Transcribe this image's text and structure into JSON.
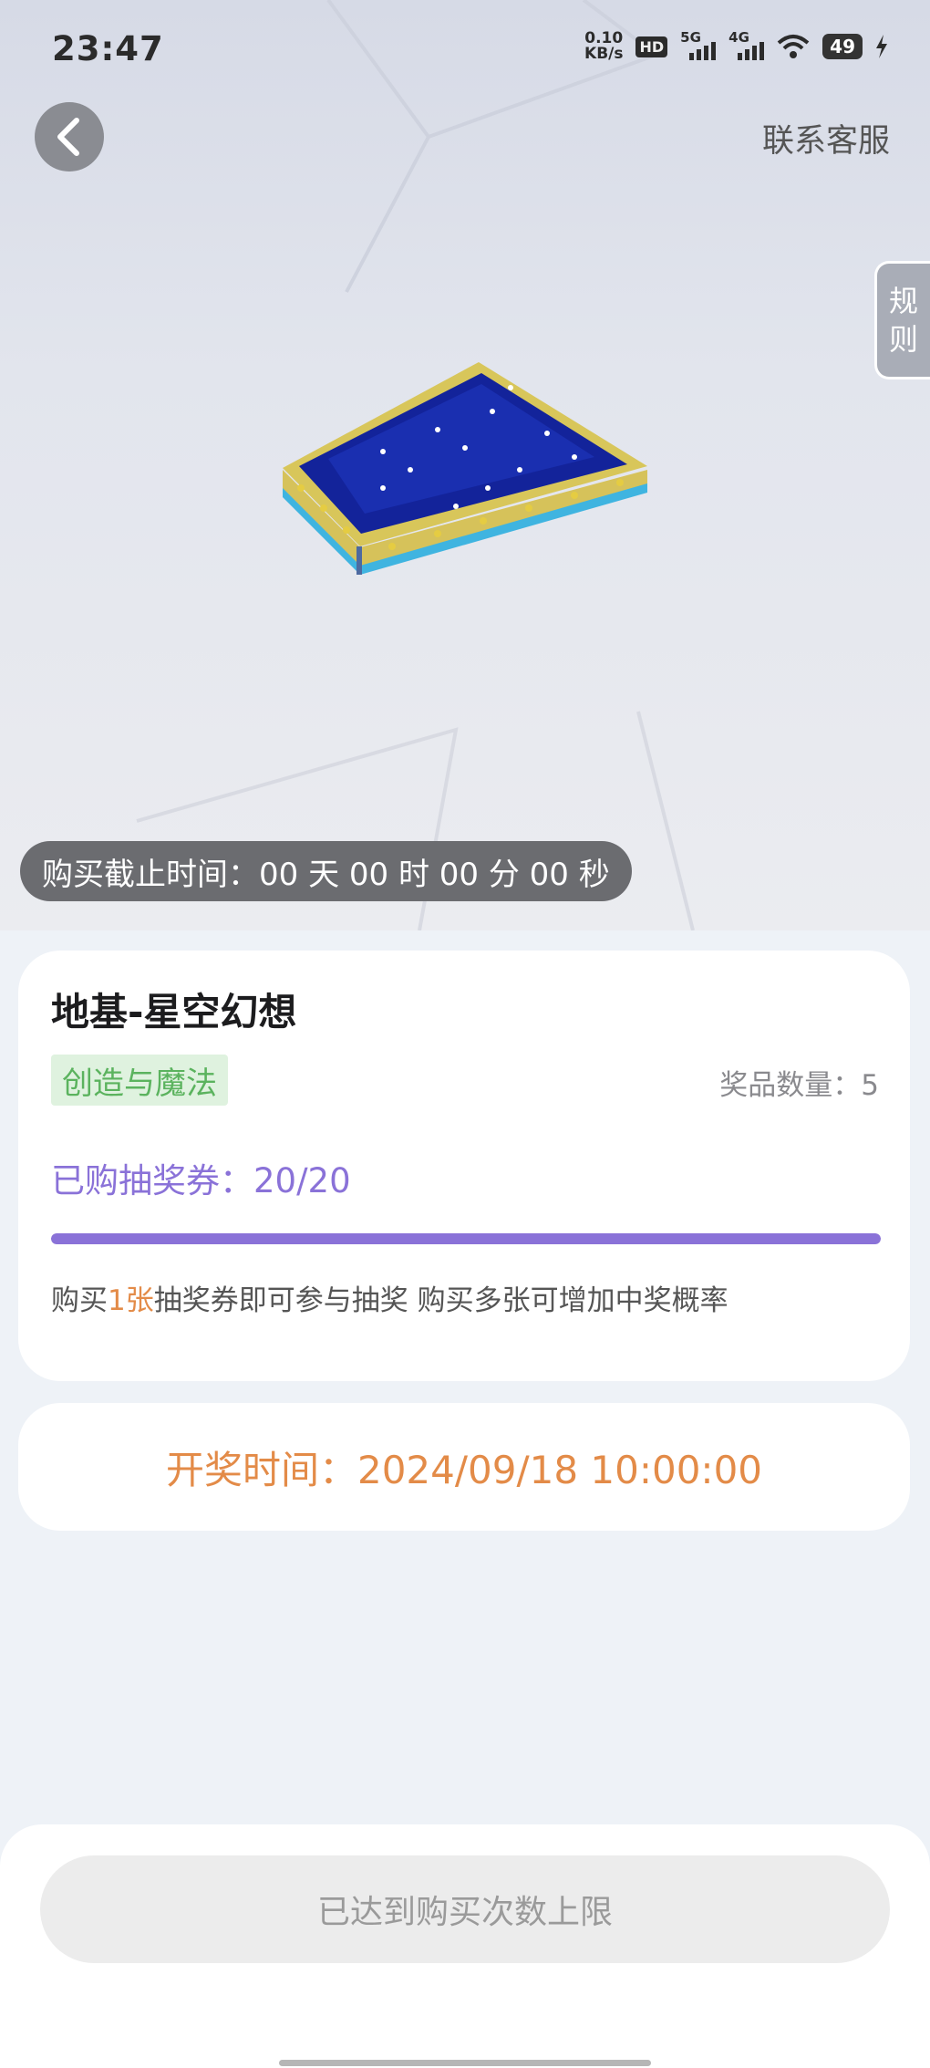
{
  "status_bar": {
    "time": "23:47",
    "net_speed_value": "0.10",
    "net_speed_unit": "KB/s",
    "hd_label": "HD",
    "signal_1_label": "5G",
    "signal_2_label": "4G",
    "battery": "49"
  },
  "header": {
    "back_icon": "chevron-left-icon",
    "service_label": "联系客服",
    "rules_label_1": "规",
    "rules_label_2": "则"
  },
  "hero": {
    "deadline_text": "购买截止时间：00 天 00 时 00 分 00 秒"
  },
  "item": {
    "title": "地基-星空幻想",
    "category": "创造与魔法",
    "prize_count": "奖品数量：5",
    "purchased": "已购抽奖券：20/20",
    "progress": 1.0,
    "hint_prefix": "购买",
    "hint_highlight": "1张",
    "hint_suffix": "抽奖券即可参与抽奖 购买多张可增加中奖概率"
  },
  "draw": {
    "time_text": "开奖时间：2024/09/18 10:00:00"
  },
  "footer": {
    "button_label": "已达到购买次数上限"
  },
  "colors": {
    "accent_purple": "#8a72d8",
    "accent_orange": "#e38b48",
    "tag_green": "#5bb35e"
  }
}
